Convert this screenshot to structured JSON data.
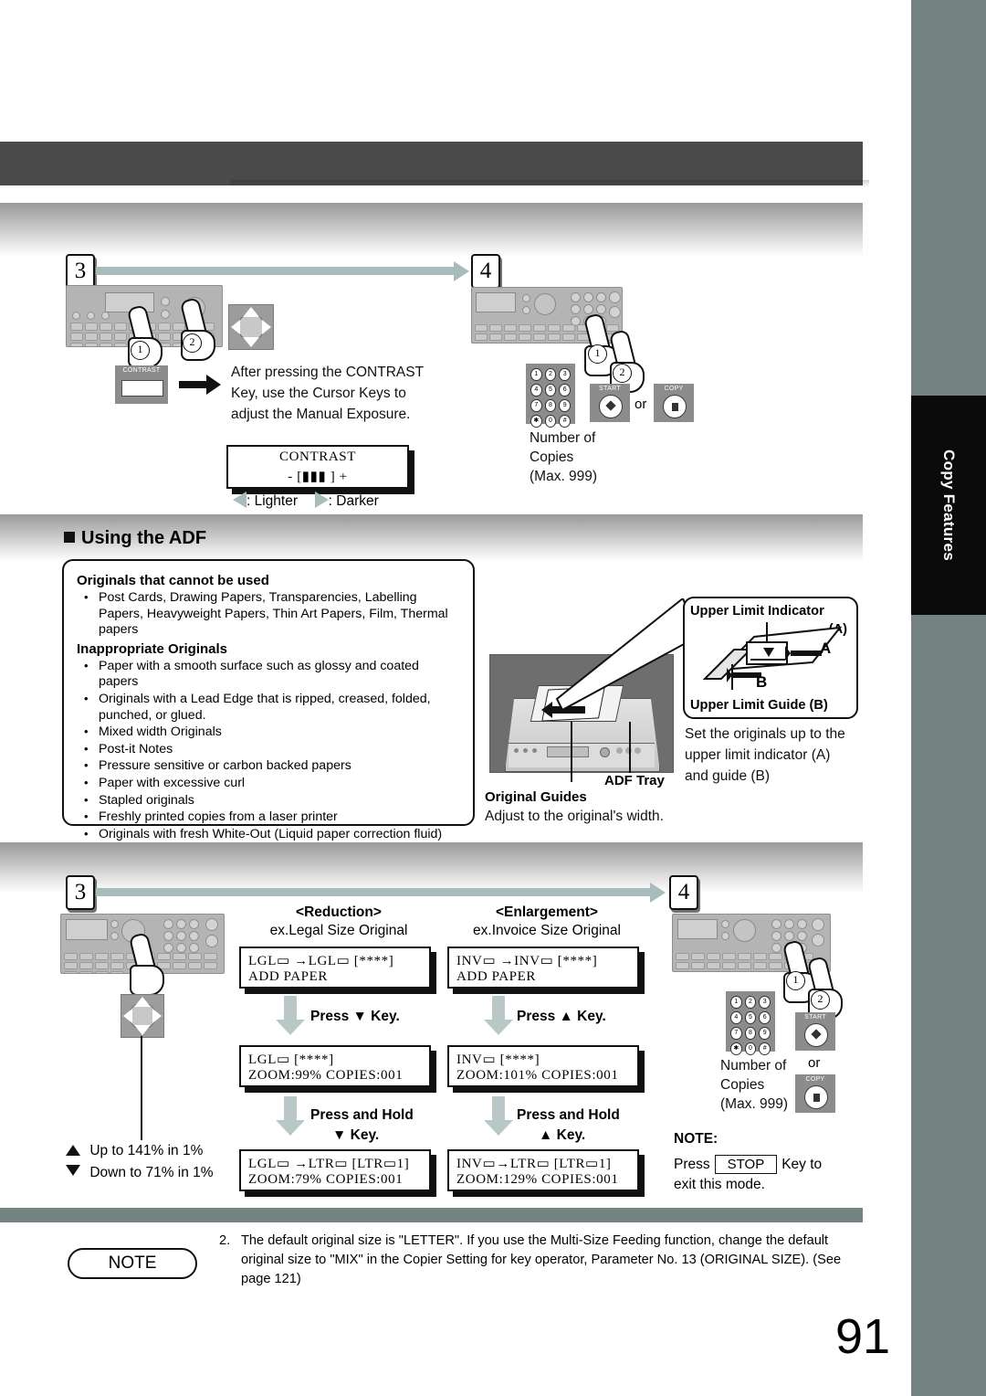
{
  "page": {
    "number": "91",
    "side_tab_label": "Copy Features"
  },
  "section_contrast": {
    "step_from": "3",
    "step_to": "4",
    "hand_markers": [
      "1",
      "2"
    ],
    "contrast_key_label": "CONTRAST",
    "instruction": "After pressing the CONTRAST Key, use the Cursor Keys to adjust the Manual Exposure.",
    "lcd": {
      "line1": "CONTRAST",
      "line2": "- [▮▮▮    ] +"
    },
    "legend_lighter": ": Lighter",
    "legend_darker": ": Darker"
  },
  "section_step4_top": {
    "step": "4",
    "hand_markers": [
      "1",
      "2"
    ],
    "numpad_keys": [
      "1",
      "2",
      "3",
      "4",
      "5",
      "6",
      "7",
      "8",
      "9",
      "✱",
      "0",
      "#"
    ],
    "start_key_label": "START",
    "copy_key_label": "COPY",
    "or_label": "or",
    "caption_line1": "Number of",
    "caption_line2": "Copies",
    "caption_line3": "(Max. 999)"
  },
  "adf": {
    "heading": "Using the ADF",
    "cannot_use_title": "Originals that cannot be used",
    "cannot_use_items": [
      "Post Cards, Drawing Papers, Transparencies, Labelling Papers, Heavyweight Papers, Thin Art Papers, Film, Thermal papers"
    ],
    "inappropriate_title": "Inappropriate Originals",
    "inappropriate_items": [
      "Paper with a smooth surface such as glossy and coated papers",
      "Originals with a Lead Edge that is ripped, creased, folded, punched, or glued.",
      "Mixed width Originals",
      "Post-it Notes",
      "Pressure sensitive or carbon backed papers",
      "Paper with excessive curl",
      "Stapled originals",
      "Freshly printed copies from a laser printer",
      "Originals with fresh White-Out (Liquid paper correction fluid)"
    ],
    "callout_box": {
      "title_top": "Upper Limit Indicator",
      "label_a": "(A)",
      "marker_a": "A",
      "marker_b": "B",
      "title_bottom": "Upper Limit Guide (B)"
    },
    "set_text": "Set the originals up to the upper limit indicator (A) and guide (B)",
    "adf_tray_label": "ADF Tray",
    "original_guides_label": "Original Guides",
    "original_guides_text": "Adjust to the original's width."
  },
  "section_zoom": {
    "step_from": "3",
    "step_to": "4",
    "up_label": "Up to 141% in 1%",
    "down_label": "Down to 71% in 1%",
    "reduction": {
      "title": "<Reduction>",
      "example": "ex.Legal Size Original",
      "screen1_line1": "LGL▭  →LGL▭   [****]",
      "screen1_line2": "ADD  PAPER",
      "action1": "Press ▼ Key.",
      "screen2_line1": "LGL▭               [****]",
      "screen2_line2": "ZOOM:99%   COPIES:001",
      "action2_l1": "Press and Hold",
      "action2_l2": "▼ Key.",
      "screen3_line1": "LGL▭ →LTR▭ [LTR▭1]",
      "screen3_line2": "ZOOM:79%   COPIES:001"
    },
    "enlargement": {
      "title": "<Enlargement>",
      "example": "ex.Invoice Size Original",
      "screen1_line1": "INV▭  →INV▭   [****]",
      "screen1_line2": "ADD  PAPER",
      "action1": "Press ▲ Key.",
      "screen2_line1": "INV▭               [****]",
      "screen2_line2": "ZOOM:101% COPIES:001",
      "action2_l1": "Press and Hold",
      "action2_l2": "▲ Key.",
      "screen3_line1": "INV▭→LTR▭ [LTR▭1]",
      "screen3_line2": "ZOOM:129% COPIES:001"
    },
    "step4": {
      "hand_markers": [
        "1",
        "2"
      ],
      "numpad_keys": [
        "1",
        "2",
        "3",
        "4",
        "5",
        "6",
        "7",
        "8",
        "9",
        "✱",
        "0",
        "#"
      ],
      "start_key_label": "START",
      "copy_key_label": "COPY",
      "or_label": "or",
      "caption_line1": "Number of",
      "caption_line2": "Copies",
      "caption_line3": "(Max. 999)",
      "note_title": "NOTE:",
      "note_before": "Press",
      "note_key": "STOP",
      "note_after": "Key to",
      "note_line2": "exit this mode."
    }
  },
  "footer_note": {
    "badge": "NOTE",
    "number": "2.",
    "text": "The default original size is \"LETTER\". If you use the Multi-Size Feeding function, change the default original size to \"MIX\" in the Copier Setting for key operator, Parameter No. 13 (ORIGINAL SIZE). (See page 121)"
  },
  "colors": {
    "side_tab_bg": "#758483",
    "top_band": "#4a4a4a",
    "flow_arrow": "#a9bcbc",
    "panel_gray": "#b4b4b4"
  }
}
